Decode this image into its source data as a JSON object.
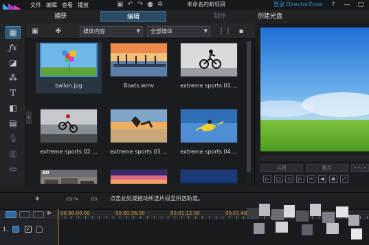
{
  "titlebar": {
    "menu": [
      "文件",
      "编辑",
      "查看",
      "播放"
    ],
    "project_title": "未命名的新项目",
    "login": "登录 DirectorZone",
    "icons": [
      "save-icon",
      "undo-icon",
      "redo-icon",
      "record-icon",
      "settings-icon"
    ],
    "window_buttons": [
      "?",
      "—",
      "□",
      "✕"
    ]
  },
  "modes": {
    "capture": "捕获",
    "edit": "编辑",
    "produce": "制作",
    "create_disc": "创建光盘"
  },
  "tools": [
    "media-room-icon",
    "fx-icon",
    "pip-icon",
    "particle-icon",
    "title-icon",
    "transition-icon",
    "audio-mixing-icon",
    "voiceover-icon",
    "chapter-icon",
    "subtitle-icon"
  ],
  "library": {
    "dropdown_content": "媒体内容",
    "dropdown_filter": "全部媒体",
    "collapse_glyph": "›",
    "items": [
      {
        "caption": "ballon.jpg",
        "selected": true
      },
      {
        "caption": "Boats.wmv",
        "selected": false
      },
      {
        "caption": "extreme sports 01....",
        "selected": false
      },
      {
        "caption": "extreme sports 02....",
        "selected": false
      },
      {
        "caption": "extreme sports 03....",
        "selected": false
      },
      {
        "caption": "extreme sports 04....",
        "selected": false
      },
      {
        "caption": "",
        "badge": "3D",
        "selected": false
      },
      {
        "caption": "",
        "selected": false
      },
      {
        "caption": "",
        "selected": false
      }
    ]
  },
  "preview": {
    "chip1": "片段",
    "chip2": "影片",
    "timecode": "- - : -"
  },
  "actions": {
    "hint": "点击此处或拖动所选片段至所选轨道。"
  },
  "timeline": {
    "ruler": [
      "00:00:00:00",
      "00:00:36:00",
      "00:01:12:00",
      "00:01:48"
    ],
    "track_number": "1."
  },
  "colors": {
    "accent": "#3f8fd1",
    "login_link": "#2e9ad6",
    "ruler_text": "#e0a43a",
    "active_tab": "#2b4a63"
  }
}
